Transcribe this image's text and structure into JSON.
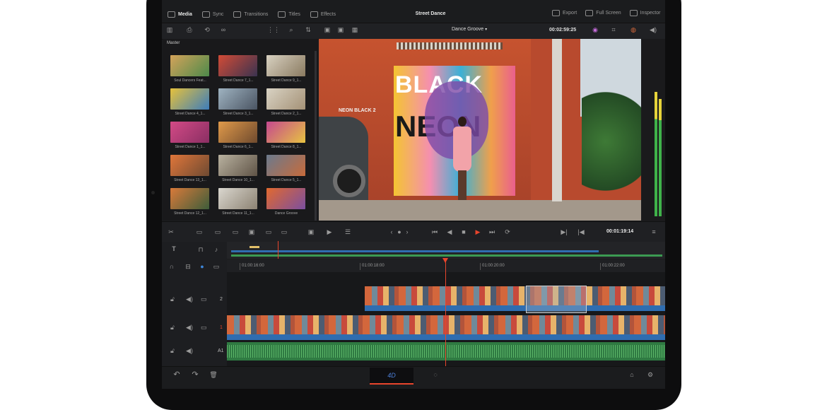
{
  "top_tabs": [
    {
      "label": "Media",
      "icon": "media-icon",
      "active": true
    },
    {
      "label": "Sync",
      "icon": "sync-icon",
      "active": false
    },
    {
      "label": "Transitions",
      "icon": "transitions-icon",
      "active": false
    },
    {
      "label": "Titles",
      "icon": "titles-icon",
      "active": false
    },
    {
      "label": "Effects",
      "icon": "effects-icon",
      "active": false
    }
  ],
  "project_title": "Street Dance",
  "right_tabs": [
    {
      "label": "Export",
      "icon": "export-icon"
    },
    {
      "label": "Full Screen",
      "icon": "full-screen-icon"
    },
    {
      "label": "Inspector",
      "icon": "inspector-icon"
    }
  ],
  "viewer": {
    "clip_name": "Dance Groove",
    "duration": "00:02:59:25",
    "playhead_timecode": "00:01:19:14"
  },
  "media_pool": {
    "bin": "Master",
    "clips": [
      {
        "label": "Soul Dancers Feat...",
        "c1": "#d4a35a",
        "c2": "#4d8a4a"
      },
      {
        "label": "Street Dance 7_1...",
        "c1": "#d24b36",
        "c2": "#3a3350"
      },
      {
        "label": "Street Dance 9_1...",
        "c1": "#d8d1c1",
        "c2": "#8a7a60"
      },
      {
        "label": "Street Dance 4_1...",
        "c1": "#e6c13c",
        "c2": "#3d7dbb"
      },
      {
        "label": "Street Dance 3_1...",
        "c1": "#9fb3c1",
        "c2": "#4a5462"
      },
      {
        "label": "Street Dance 2_1...",
        "c1": "#d9d3c4",
        "c2": "#a49176"
      },
      {
        "label": "Street Dance 1_1...",
        "c1": "#d34a86",
        "c2": "#8a2f63"
      },
      {
        "label": "Street Dance 6_1...",
        "c1": "#e09a4a",
        "c2": "#6f4a2e"
      },
      {
        "label": "Street Dance 8_1...",
        "c1": "#c5488f",
        "c2": "#e7c341"
      },
      {
        "label": "Street Dance 13_1...",
        "c1": "#e0763a",
        "c2": "#6e4a32"
      },
      {
        "label": "Street Dance 10_1...",
        "c1": "#b9b2a0",
        "c2": "#5f5346"
      },
      {
        "label": "Street Dance 5_1...",
        "c1": "#6b7a8d",
        "c2": "#c76b3b"
      },
      {
        "label": "Street Dance 12_1...",
        "c1": "#d97a3a",
        "c2": "#3e5d3a"
      },
      {
        "label": "Street Dance 11_1...",
        "c1": "#dad7cf",
        "c2": "#8c8272"
      },
      {
        "label": "Dance Groove",
        "c1": "#e1692f",
        "c2": "#7b4fa0"
      }
    ]
  },
  "timeline": {
    "ruler": [
      "01:00:16:00",
      "01:00:18:00",
      "01:00:20:00",
      "01:00:22:00"
    ],
    "tracks": [
      {
        "label": "2"
      },
      {
        "label": "1"
      },
      {
        "label": "A1"
      }
    ]
  },
  "colors": {
    "accent": "#e8452c",
    "clip_blue": "#2f6db0",
    "audio_green": "#3c9a52",
    "panel": "#1b1c1e"
  }
}
